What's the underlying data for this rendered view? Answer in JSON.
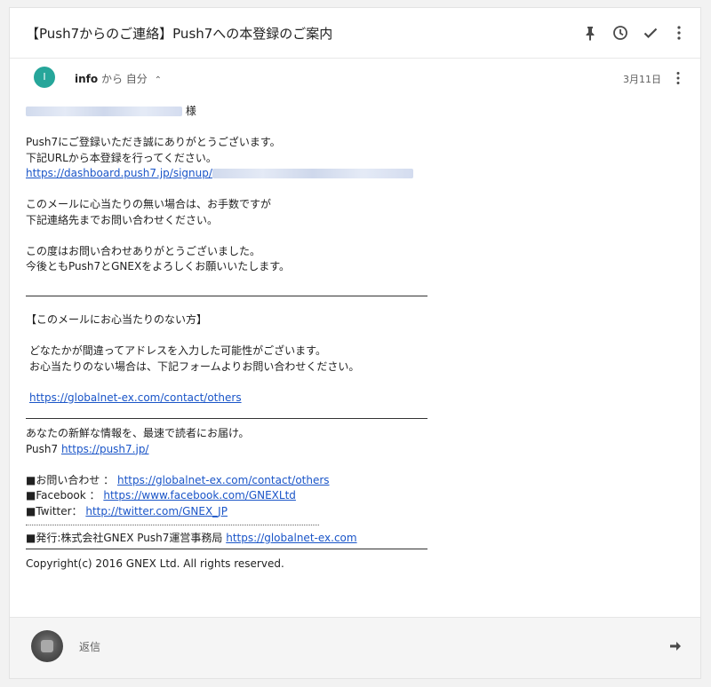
{
  "subject": "【Push7からのご連絡】Push7への本登録のご案内",
  "sender": {
    "avatar_letter": "I",
    "from": "info",
    "from_suffix": " から ",
    "to": "自分",
    "chevron": "⌃",
    "date": "3月11日"
  },
  "body": {
    "salutation": "様",
    "p1": "Push7にご登録いただき誠にありがとうございます。",
    "p2": "下記URLから本登録を行ってください。",
    "signup_link": "https://dashboard.push7.jp/signup/",
    "p3": "このメールに心当たりの無い場合は、お手数ですが",
    "p4": "下記連絡先までお問い合わせください。",
    "p5": "この度はお問い合わせありがとうございました。",
    "p6": "今後ともPush7とGNEXをよろしくお願いいたします。",
    "notice_heading": "【このメールにお心当たりのない方】",
    "notice_p1": "どなたかが間違ってアドレスを入力した可能性がございます。",
    "notice_p2": "お心当たりのない場合は、下記フォームよりお問い合わせください。",
    "notice_link": "https://globalnet-ex.com/contact/others",
    "footer_tagline": "あなたの新鮮な情報を、最速で読者にお届け。",
    "footer_push7_label": "Push7 ",
    "footer_push7_link": "https://push7.jp/",
    "contact_label": "■お問い合わせ ： ",
    "contact_link": "https://globalnet-ex.com/contact/others",
    "facebook_label": "■Facebook ： ",
    "facebook_link": "https://www.facebook.com/GNEXLtd",
    "twitter_label": "■Twitter： ",
    "twitter_link": "http://twitter.com/GNEX_JP",
    "publisher_label": "■発行:株式会社GNEX Push7運営事務局 ",
    "publisher_link": "https://globalnet-ex.com",
    "copyright": "Copyright(c) 2016 GNEX Ltd. All rights reserved."
  },
  "reply": {
    "label": "返信"
  },
  "colors": {
    "link": "#1a55c8",
    "avatar": "#26a69a"
  }
}
